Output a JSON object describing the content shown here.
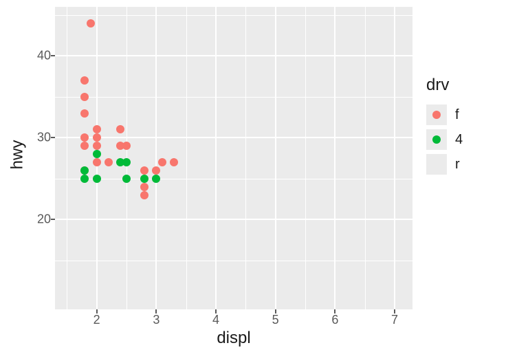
{
  "chart_data": {
    "type": "scatter",
    "xlabel": "displ",
    "ylabel": "hwy",
    "xlim": [
      1.3,
      7.3
    ],
    "ylim": [
      9,
      46
    ],
    "x_ticks": [
      2,
      3,
      4,
      5,
      6,
      7
    ],
    "y_ticks": [
      20,
      30,
      40
    ],
    "x_minor": [
      1.5,
      2.5,
      3.5,
      4.5,
      5.5,
      6.5
    ],
    "y_minor": [
      15,
      25,
      35,
      45
    ],
    "legend_title": "drv",
    "legend_entries": [
      "f",
      "4",
      "r"
    ],
    "colors": {
      "f": "#f8766d",
      "4": "#00ba38",
      "r": "#619cff"
    },
    "series": [
      {
        "name": "f",
        "points": [
          {
            "x": 1.8,
            "y": 29
          },
          {
            "x": 1.8,
            "y": 30
          },
          {
            "x": 1.8,
            "y": 33
          },
          {
            "x": 1.8,
            "y": 35
          },
          {
            "x": 1.8,
            "y": 37
          },
          {
            "x": 1.8,
            "y": 26
          },
          {
            "x": 1.9,
            "y": 44
          },
          {
            "x": 2.0,
            "y": 27
          },
          {
            "x": 2.0,
            "y": 29
          },
          {
            "x": 2.0,
            "y": 30
          },
          {
            "x": 2.0,
            "y": 31
          },
          {
            "x": 2.2,
            "y": 27
          },
          {
            "x": 2.4,
            "y": 29
          },
          {
            "x": 2.4,
            "y": 31
          },
          {
            "x": 2.5,
            "y": 29
          },
          {
            "x": 2.8,
            "y": 23
          },
          {
            "x": 2.8,
            "y": 24
          },
          {
            "x": 2.8,
            "y": 26
          },
          {
            "x": 3.0,
            "y": 26
          },
          {
            "x": 3.1,
            "y": 27
          },
          {
            "x": 3.3,
            "y": 27
          }
        ]
      },
      {
        "name": "4",
        "points": [
          {
            "x": 1.8,
            "y": 25
          },
          {
            "x": 1.8,
            "y": 26
          },
          {
            "x": 2.0,
            "y": 28
          },
          {
            "x": 2.0,
            "y": 25
          },
          {
            "x": 2.4,
            "y": 27
          },
          {
            "x": 2.5,
            "y": 25
          },
          {
            "x": 2.5,
            "y": 27
          },
          {
            "x": 2.8,
            "y": 25
          },
          {
            "x": 3.0,
            "y": 25
          }
        ]
      },
      {
        "name": "r",
        "points": []
      }
    ]
  }
}
